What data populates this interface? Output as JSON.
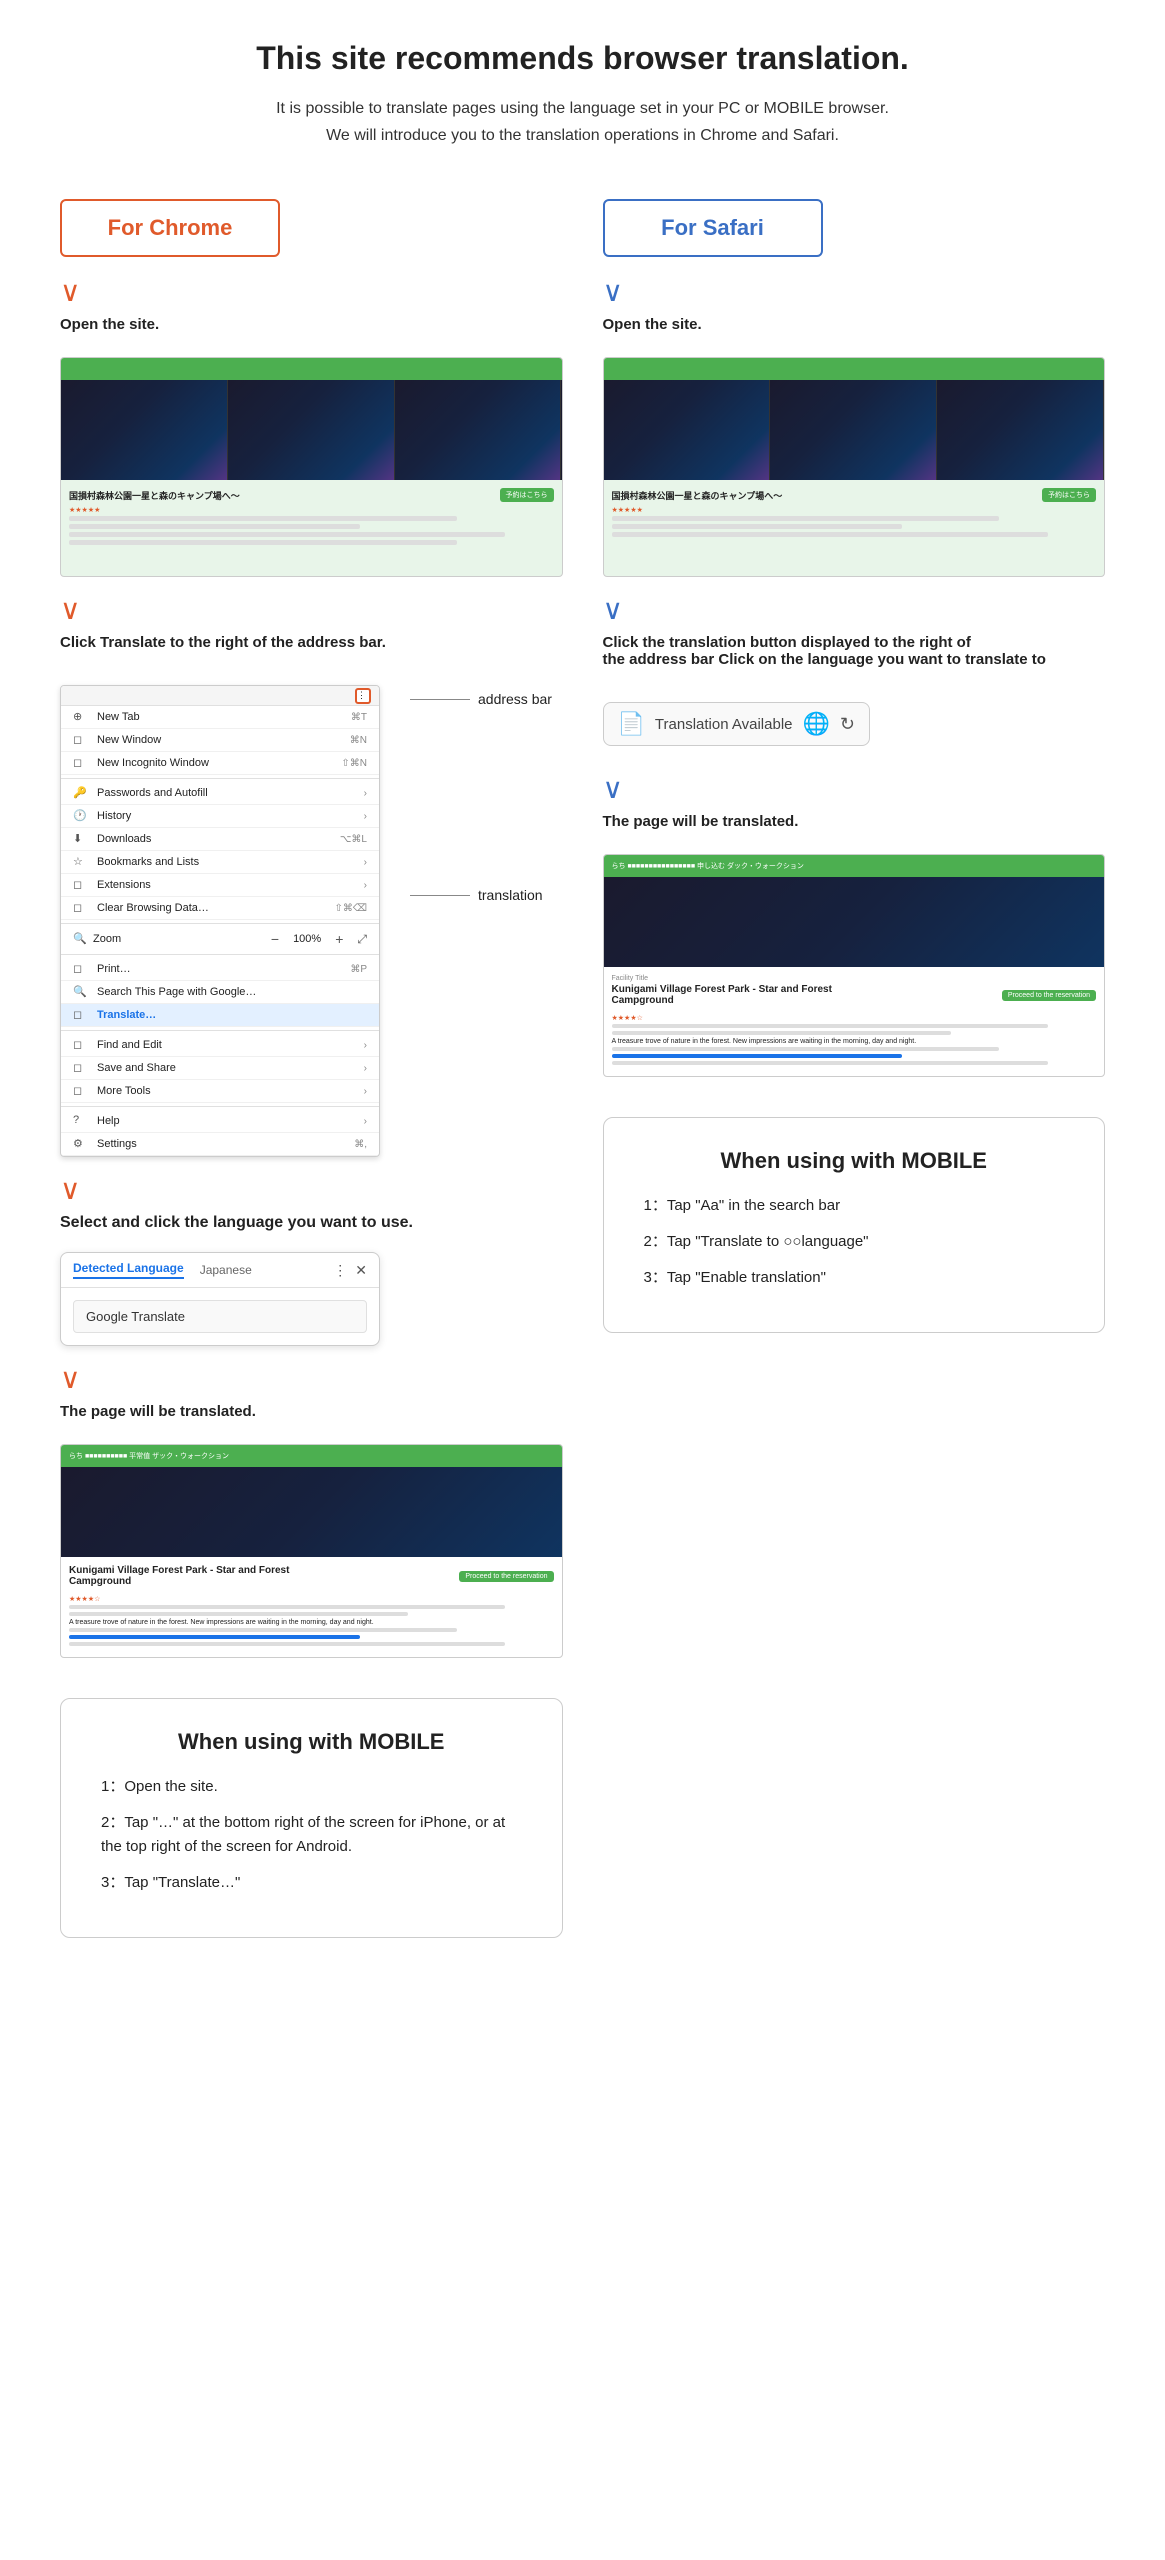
{
  "page": {
    "main_title": "This site recommends browser translation.",
    "subtitle_line1": "It is possible to translate pages using the language set in your PC or MOBILE browser.",
    "subtitle_line2": "We will introduce you to the translation operations in Chrome and Safari.",
    "chrome": {
      "label": "For Chrome",
      "step1": "Open the site.",
      "step2": "Click Translate to the right of the address bar.",
      "annotation_address": "address bar",
      "annotation_translation": "translation",
      "step3": "Select and click the language you want to use.",
      "step4": "The page will be translated.",
      "popup_tab1": "Detected Language",
      "popup_tab2": "Japanese",
      "popup_body": "Google Translate"
    },
    "safari": {
      "label": "For Safari",
      "step1": "Open the site.",
      "step2_line1": "Click the translation button displayed to the right of",
      "step2_line2": "the address bar Click on the language you want to translate to",
      "translate_bar_text": "Translation Available",
      "step3": "The page will be translated."
    },
    "mobile_safari": {
      "title": "When using with MOBILE",
      "item1": "1：Tap \"Aa\" in the search bar",
      "item2": "2：Tap \"Translate to ○○language\"",
      "item3": "3：Tap \"Enable translation\""
    },
    "mobile_chrome": {
      "title": "When using with MOBILE",
      "item1": "1：Open the site.",
      "item2": "2：Tap \"…\" at the bottom right of the screen for iPhone, or at the top right of the screen for Android.",
      "item3": "3：Tap \"Translate…\""
    },
    "menu_items": [
      {
        "icon": "⊕",
        "text": "New Tab",
        "shortcut": "⌘T",
        "arrow": ""
      },
      {
        "icon": "◻",
        "text": "New Window",
        "shortcut": "⌘N",
        "arrow": ""
      },
      {
        "icon": "◻",
        "text": "New Incognito Window",
        "shortcut": "⇧⌘N",
        "arrow": ""
      },
      {
        "icon": "",
        "text": "",
        "shortcut": "",
        "arrow": "",
        "divider": true
      },
      {
        "icon": "🔑",
        "text": "Passwords and Autofill",
        "shortcut": "",
        "arrow": "›"
      },
      {
        "icon": "🕐",
        "text": "History",
        "shortcut": "",
        "arrow": "›"
      },
      {
        "icon": "⬇",
        "text": "Downloads",
        "shortcut": "⌥⌘L",
        "arrow": ""
      },
      {
        "icon": "☆",
        "text": "Bookmarks and Lists",
        "shortcut": "",
        "arrow": "›"
      },
      {
        "icon": "◻",
        "text": "Extensions",
        "shortcut": "",
        "arrow": "›"
      },
      {
        "icon": "◻",
        "text": "Clear Browsing Data…",
        "shortcut": "⇧⌘⌫",
        "arrow": ""
      },
      {
        "icon": "",
        "text": "",
        "shortcut": "",
        "arrow": "",
        "divider": true
      },
      {
        "icon": "🔍",
        "text": "Zoom",
        "shortcut": "— 100%  +",
        "arrow": "⤢"
      },
      {
        "icon": "",
        "text": "",
        "shortcut": "",
        "arrow": "",
        "divider": true
      },
      {
        "icon": "◻",
        "text": "Print…",
        "shortcut": "⌘P",
        "arrow": ""
      },
      {
        "icon": "🔍",
        "text": "Search This Page with Google…",
        "shortcut": "",
        "arrow": ""
      },
      {
        "icon": "◻",
        "text": "Translate…",
        "shortcut": "",
        "arrow": "",
        "highlighted": true
      },
      {
        "icon": "",
        "text": "",
        "shortcut": "",
        "arrow": "",
        "divider": true
      },
      {
        "icon": "◻",
        "text": "Find and Edit",
        "shortcut": "",
        "arrow": "›"
      },
      {
        "icon": "◻",
        "text": "Save and Share",
        "shortcut": "",
        "arrow": "›"
      },
      {
        "icon": "◻",
        "text": "More Tools",
        "shortcut": "",
        "arrow": "›"
      },
      {
        "icon": "",
        "text": "",
        "shortcut": "",
        "arrow": "",
        "divider": true
      },
      {
        "icon": "?",
        "text": "Help",
        "shortcut": "",
        "arrow": "›"
      },
      {
        "icon": "⚙",
        "text": "Settings",
        "shortcut": "⌘,",
        "arrow": ""
      }
    ]
  }
}
